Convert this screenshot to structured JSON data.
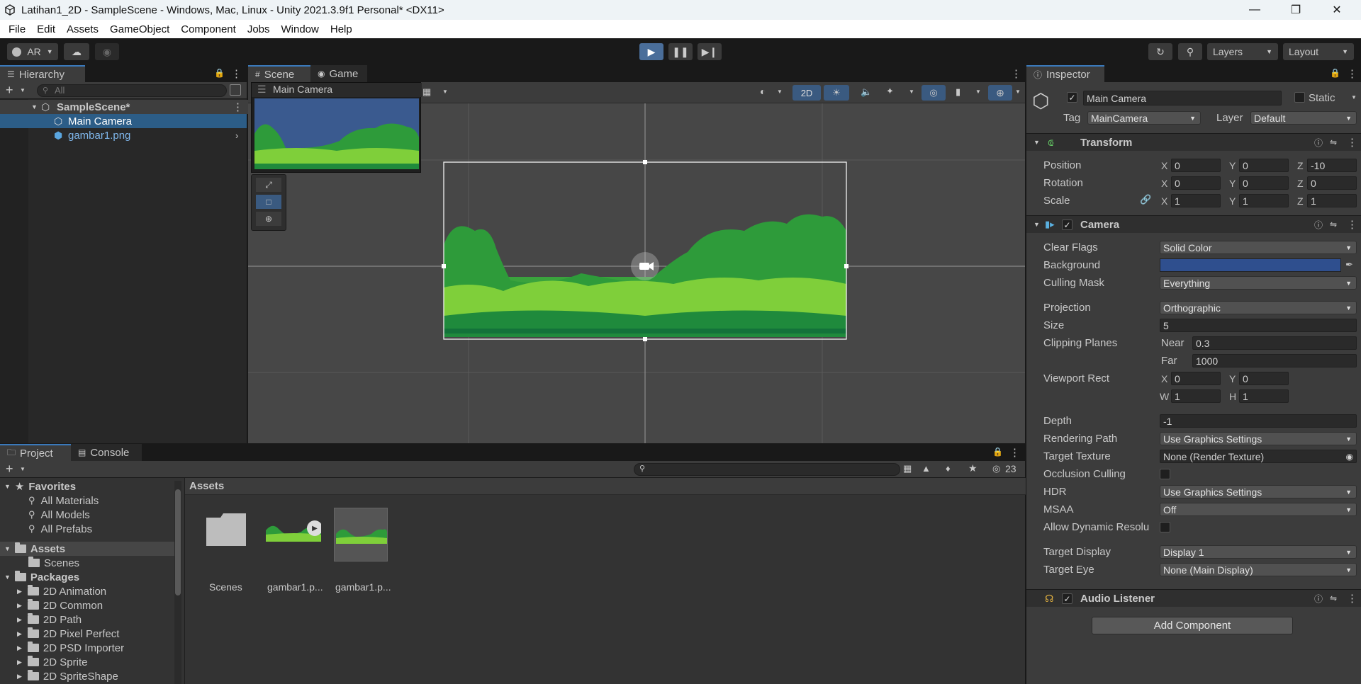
{
  "window": {
    "title": "Latihan1_2D - SampleScene - Windows, Mac, Linux - Unity 2021.3.9f1 Personal* <DX11>"
  },
  "menu": [
    "File",
    "Edit",
    "Assets",
    "GameObject",
    "Component",
    "Jobs",
    "Window",
    "Help"
  ],
  "toolbar": {
    "account": "AR",
    "layers": "Layers",
    "layout": "Layout"
  },
  "hierarchy": {
    "tab": "Hierarchy",
    "search_placeholder": "All",
    "scene": "SampleScene*",
    "items": [
      "Main Camera",
      "gambar1.png"
    ]
  },
  "scene_view": {
    "tabs": [
      "Scene",
      "Game"
    ],
    "mode_2d": "2D",
    "camera_preview_title": "Main Camera"
  },
  "inspector": {
    "tab": "Inspector",
    "object_name": "Main Camera",
    "static_label": "Static",
    "tag_label": "Tag",
    "tag_value": "MainCamera",
    "layer_label": "Layer",
    "layer_value": "Default",
    "transform": {
      "title": "Transform",
      "position_label": "Position",
      "rotation_label": "Rotation",
      "scale_label": "Scale",
      "position": [
        "0",
        "0",
        "-10"
      ],
      "rotation": [
        "0",
        "0",
        "0"
      ],
      "scale": [
        "1",
        "1",
        "1"
      ]
    },
    "camera": {
      "title": "Camera",
      "clear_flags_label": "Clear Flags",
      "clear_flags": "Solid Color",
      "background_label": "Background",
      "background_color": "#2f4f8e",
      "culling_mask_label": "Culling Mask",
      "culling_mask": "Everything",
      "projection_label": "Projection",
      "projection": "Orthographic",
      "size_label": "Size",
      "size": "5",
      "clipping_label": "Clipping Planes",
      "near_label": "Near",
      "near": "0.3",
      "far_label": "Far",
      "far": "1000",
      "viewport_label": "Viewport Rect",
      "viewport": {
        "x": "0",
        "y": "0",
        "w": "1",
        "h": "1"
      },
      "depth_label": "Depth",
      "depth": "-1",
      "rendering_path_label": "Rendering Path",
      "rendering_path": "Use Graphics Settings",
      "target_texture_label": "Target Texture",
      "target_texture": "None (Render Texture)",
      "occlusion_label": "Occlusion Culling",
      "hdr_label": "HDR",
      "hdr": "Use Graphics Settings",
      "msaa_label": "MSAA",
      "msaa": "Off",
      "dynamic_res_label": "Allow Dynamic Resolu",
      "target_display_label": "Target Display",
      "target_display": "Display 1",
      "target_eye_label": "Target Eye",
      "target_eye": "None (Main Display)"
    },
    "audio_listener": "Audio Listener",
    "add_component": "Add Component"
  },
  "project": {
    "tabs": [
      "Project",
      "Console"
    ],
    "hidden_count": "23",
    "favorites_label": "Favorites",
    "favorites": [
      "All Materials",
      "All Models",
      "All Prefabs"
    ],
    "assets_label": "Assets",
    "assets_children": [
      "Scenes"
    ],
    "packages_label": "Packages",
    "packages": [
      "2D Animation",
      "2D Common",
      "2D Path",
      "2D Pixel Perfect",
      "2D PSD Importer",
      "2D Sprite",
      "2D SpriteShape"
    ],
    "breadcrumb": "Assets",
    "grid": [
      "Scenes",
      "gambar1.p...",
      "gambar1.p..."
    ]
  },
  "colors": {
    "accent": "#3a79bb",
    "selection": "#2c5d87",
    "editor_bg": "#282828"
  }
}
